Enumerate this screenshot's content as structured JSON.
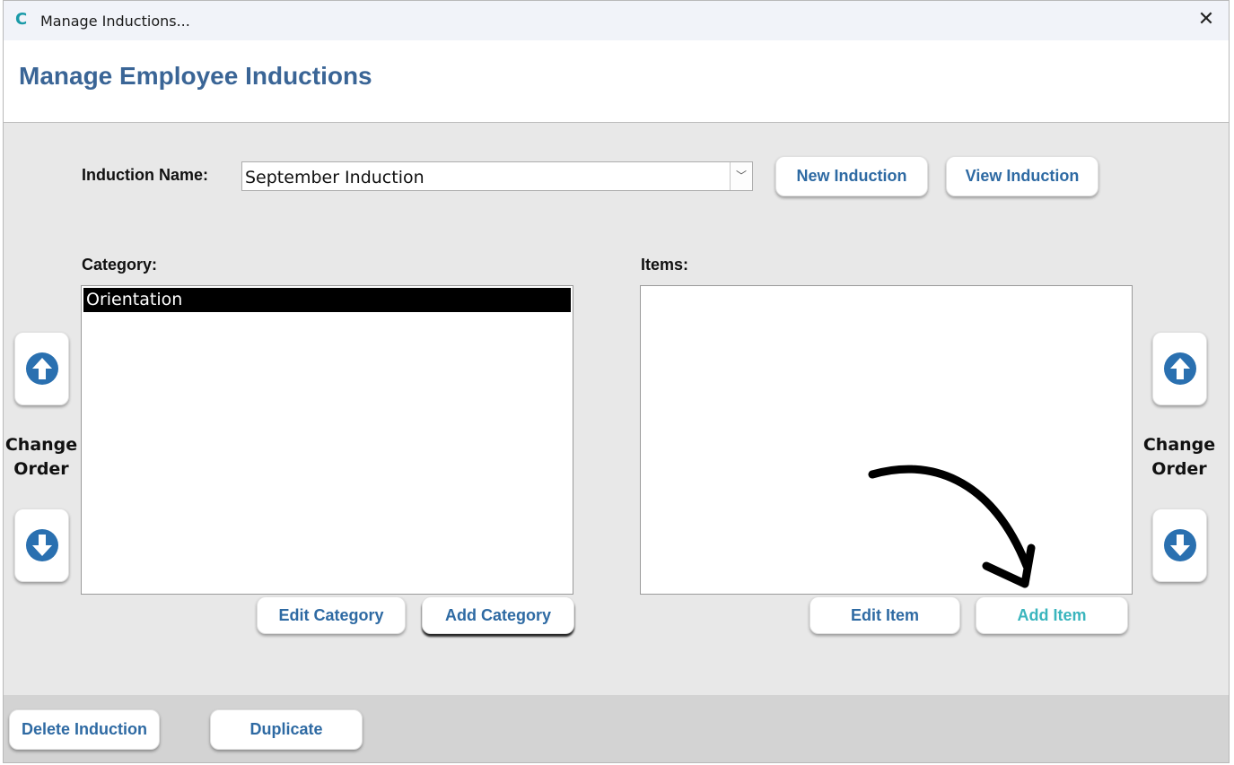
{
  "window": {
    "title": "Manage Inductions...",
    "app_icon_glyph": "C",
    "close_glyph": "✕"
  },
  "header": {
    "title": "Manage Employee Inductions"
  },
  "induction": {
    "label": "Induction Name:",
    "selected": "September Induction",
    "dropdown_glyph": "﹀",
    "new_button": "New Induction",
    "view_button": "View Induction"
  },
  "category": {
    "label": "Category:",
    "items": [
      "Orientation"
    ],
    "edit_button": "Edit Category",
    "add_button": "Add Category"
  },
  "items": {
    "label": "Items:",
    "entries": [],
    "edit_button": "Edit Item",
    "add_button": "Add Item"
  },
  "change_order": {
    "left_line1": "Change",
    "left_line2": "Order",
    "right_line1": "Change",
    "right_line2": "Order"
  },
  "footer": {
    "delete_button": "Delete Induction",
    "duplicate_button": "Duplicate"
  },
  "colors": {
    "title_blue": "#3a6596",
    "button_text": "#2e6aa3",
    "accent_teal": "#3ab5bd",
    "arrow_icon": "#2a70b0"
  },
  "icons": {
    "up": "arrow-up-circle-icon",
    "down": "arrow-down-circle-icon",
    "annotation": "curved-arrow-annotation"
  }
}
